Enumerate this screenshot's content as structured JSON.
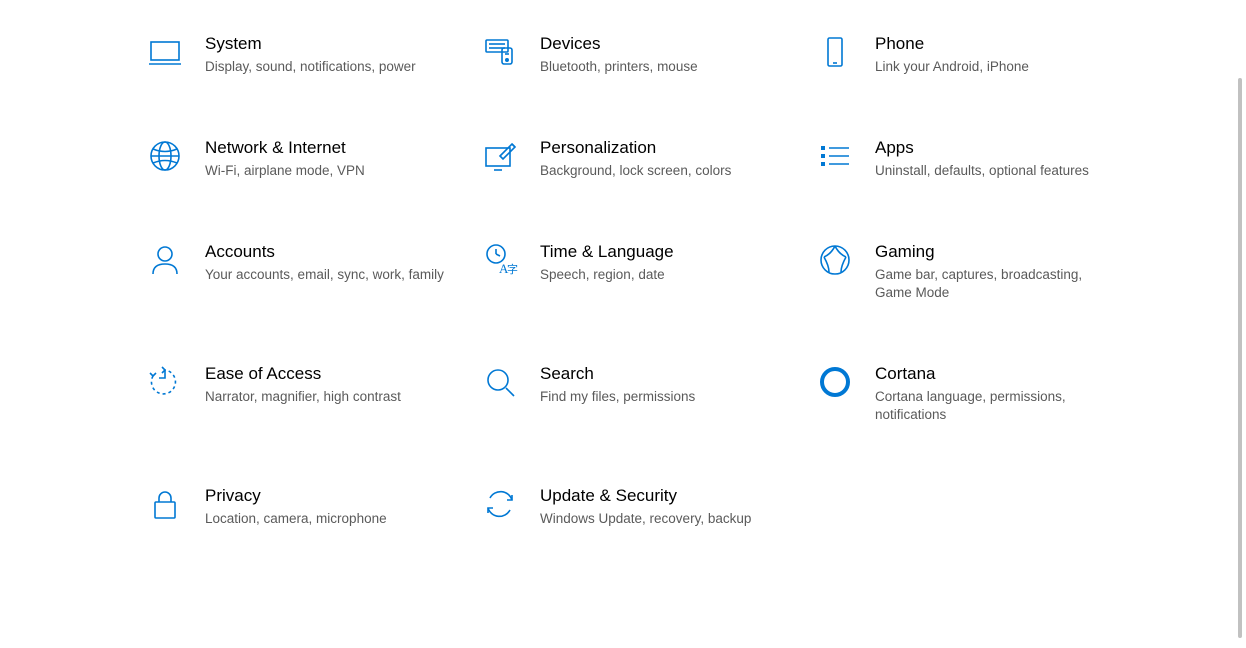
{
  "accent": "#0078D4",
  "settings": [
    {
      "icon": "system-icon",
      "title": "System",
      "desc": "Display, sound, notifications, power"
    },
    {
      "icon": "devices-icon",
      "title": "Devices",
      "desc": "Bluetooth, printers, mouse"
    },
    {
      "icon": "phone-icon",
      "title": "Phone",
      "desc": "Link your Android, iPhone"
    },
    {
      "icon": "network-icon",
      "title": "Network & Internet",
      "desc": "Wi-Fi, airplane mode, VPN"
    },
    {
      "icon": "personalization-icon",
      "title": "Personalization",
      "desc": "Background, lock screen, colors"
    },
    {
      "icon": "apps-icon",
      "title": "Apps",
      "desc": "Uninstall, defaults, optional features"
    },
    {
      "icon": "accounts-icon",
      "title": "Accounts",
      "desc": "Your accounts, email, sync, work, family"
    },
    {
      "icon": "time-language-icon",
      "title": "Time & Language",
      "desc": "Speech, region, date"
    },
    {
      "icon": "gaming-icon",
      "title": "Gaming",
      "desc": "Game bar, captures, broadcasting, Game Mode"
    },
    {
      "icon": "ease-of-access-icon",
      "title": "Ease of Access",
      "desc": "Narrator, magnifier, high contrast"
    },
    {
      "icon": "search-icon",
      "title": "Search",
      "desc": "Find my files, permissions"
    },
    {
      "icon": "cortana-icon",
      "title": "Cortana",
      "desc": "Cortana language, permissions, notifications"
    },
    {
      "icon": "privacy-icon",
      "title": "Privacy",
      "desc": "Location, camera, microphone"
    },
    {
      "icon": "update-security-icon",
      "title": "Update & Security",
      "desc": "Windows Update, recovery, backup"
    }
  ]
}
